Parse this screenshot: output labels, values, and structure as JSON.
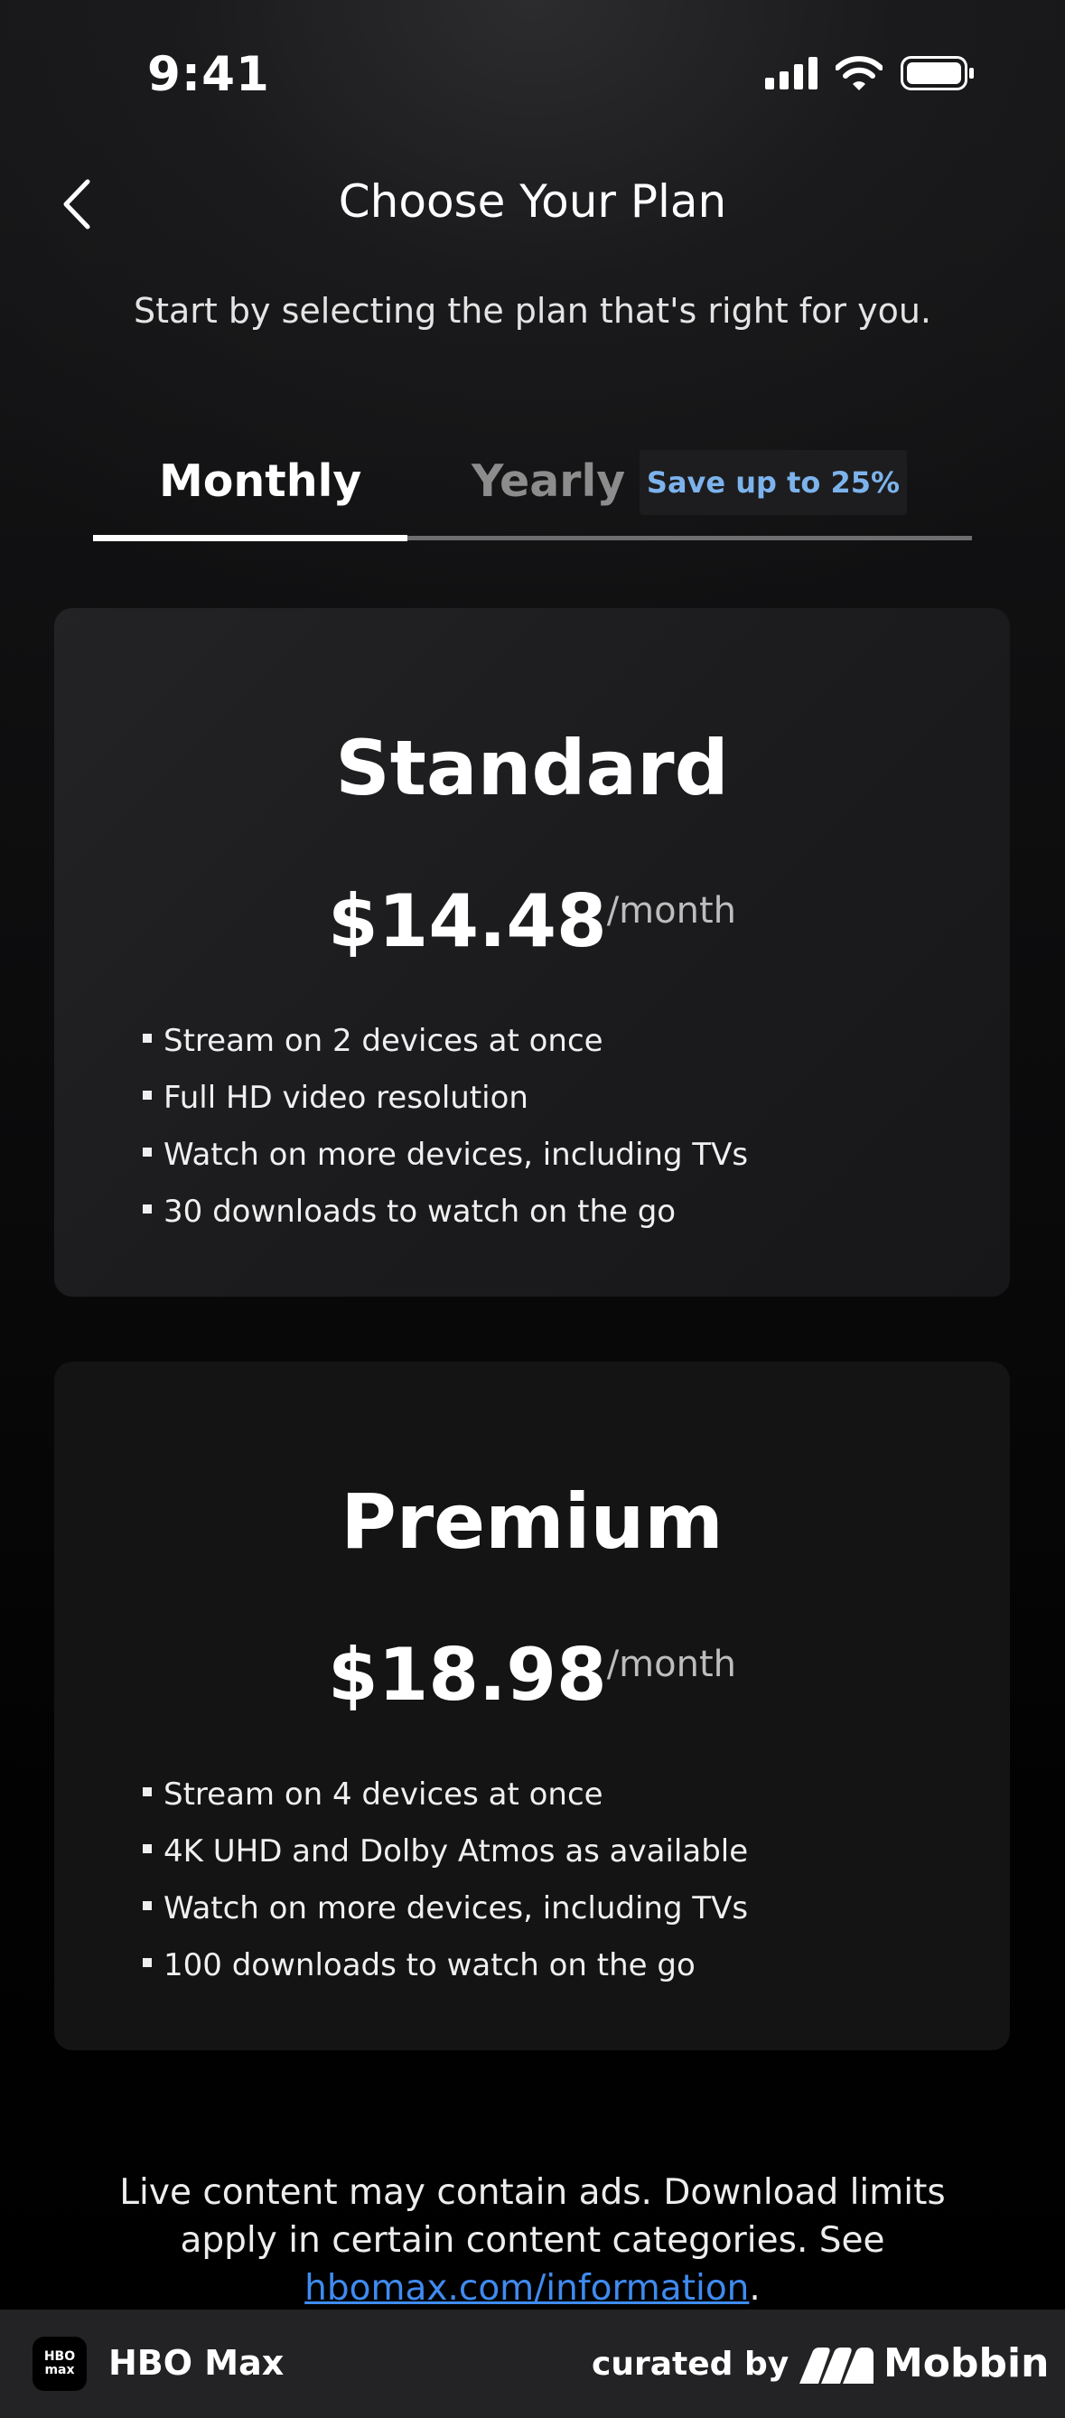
{
  "status_bar": {
    "time": "9:41",
    "icons": [
      "cellular-signal-icon",
      "wifi-icon",
      "battery-icon"
    ]
  },
  "header": {
    "back_icon": "chevron-left-icon",
    "title": "Choose Your Plan",
    "subtitle": "Start by selecting the plan that's right for you."
  },
  "tabs": {
    "items": [
      {
        "label": "Monthly",
        "selected": true
      },
      {
        "label": "Yearly",
        "selected": false
      }
    ],
    "badge": "Save up to 25%"
  },
  "plans": [
    {
      "name": "Standard",
      "price": "$14.48",
      "period": "/month",
      "features": [
        "Stream on 2 devices at once",
        "Full HD video resolution",
        "Watch on more devices, including TVs",
        "30 downloads to watch on the go"
      ]
    },
    {
      "name": "Premium",
      "price": "$18.98",
      "period": "/month",
      "features": [
        "Stream on 4 devices at once",
        "4K UHD and Dolby Atmos as available",
        "Watch on more devices, including TVs",
        "100 downloads to watch on the go"
      ]
    }
  ],
  "disclaimer": {
    "text": "Live content may contain ads. Download limits apply in certain content categories. See ",
    "link": "hbomax.com/information",
    "end": "."
  },
  "footer": {
    "logo_line1": "HBO",
    "logo_line2": "max",
    "app_name": "HBO Max",
    "curated_by": "curated by",
    "brand": "Mobbin"
  },
  "colors": {
    "accent_blue": "#3f8bf0",
    "badge_text": "#7db3ec",
    "card_background": "#19191b",
    "background": "#000000"
  }
}
